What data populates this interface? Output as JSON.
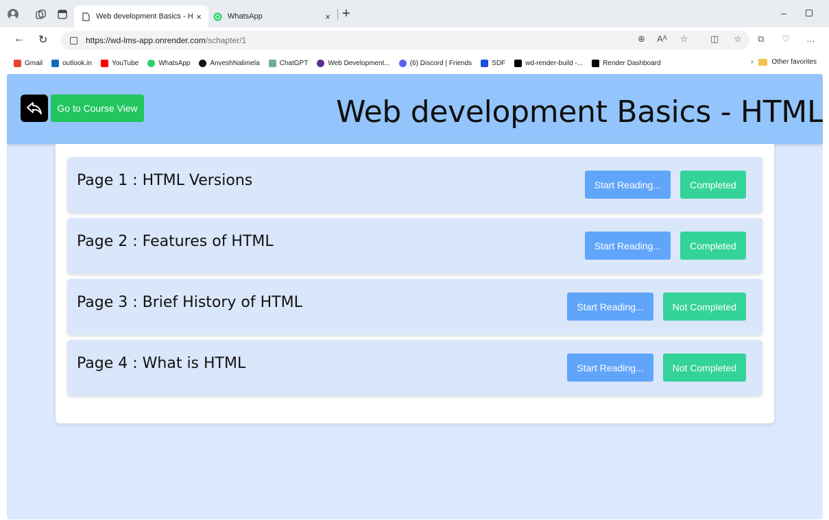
{
  "browser": {
    "tabs": [
      {
        "title": "Web development Basics - HTML",
        "active": true,
        "close": "×"
      },
      {
        "title": "WhatsApp",
        "active": false,
        "close": "×"
      }
    ],
    "new_tab": "+",
    "minimize": "–",
    "address": {
      "host": "https://wd-lms-app.onrender.com",
      "path": "/schapter/1"
    },
    "bookmarks": [
      {
        "label": "Gmail",
        "icon": "gmail-icon",
        "color": "#ea4335"
      },
      {
        "label": "outlook.in",
        "icon": "outlook-icon",
        "color": "#0f6cbd"
      },
      {
        "label": "YouTube",
        "icon": "youtube-icon",
        "color": "#ff0000"
      },
      {
        "label": "WhatsApp",
        "icon": "whatsapp-icon",
        "color": "#25d366"
      },
      {
        "label": "AnveshNalimela",
        "icon": "github-icon",
        "color": "#111111"
      },
      {
        "label": "ChatGPT",
        "icon": "chatgpt-icon",
        "color": "#74aa9c"
      },
      {
        "label": "Web Development...",
        "icon": "web-dev-icon",
        "color": "#5b2d90"
      },
      {
        "label": "(6) Discord | Friends",
        "icon": "discord-icon",
        "color": "#5865f2"
      },
      {
        "label": "SDF",
        "icon": "sdf-icon",
        "color": "#1d4ed8"
      },
      {
        "label": "wd-render-build -...",
        "icon": "render-icon",
        "color": "#000000"
      },
      {
        "label": "Render Dashboard",
        "icon": "render-icon",
        "color": "#000000"
      }
    ],
    "other_favorites": "Other favorites"
  },
  "page": {
    "go_to_course_label": "Go to Course View",
    "title": "Web development Basics - HTML",
    "accent_header": "#93c4fb",
    "pages": [
      {
        "title": "Page 1 : HTML Versions",
        "read_label": "Start Reading...",
        "status_label": "Completed"
      },
      {
        "title": "Page 2 : Features of HTML",
        "read_label": "Start Reading...",
        "status_label": "Completed"
      },
      {
        "title": "Page 3 : Brief History of HTML",
        "read_label": "Start Reading...",
        "status_label": "Not Completed"
      },
      {
        "title": "Page 4 : What is HTML",
        "read_label": "Start Reading...",
        "status_label": "Not Completed"
      }
    ]
  }
}
